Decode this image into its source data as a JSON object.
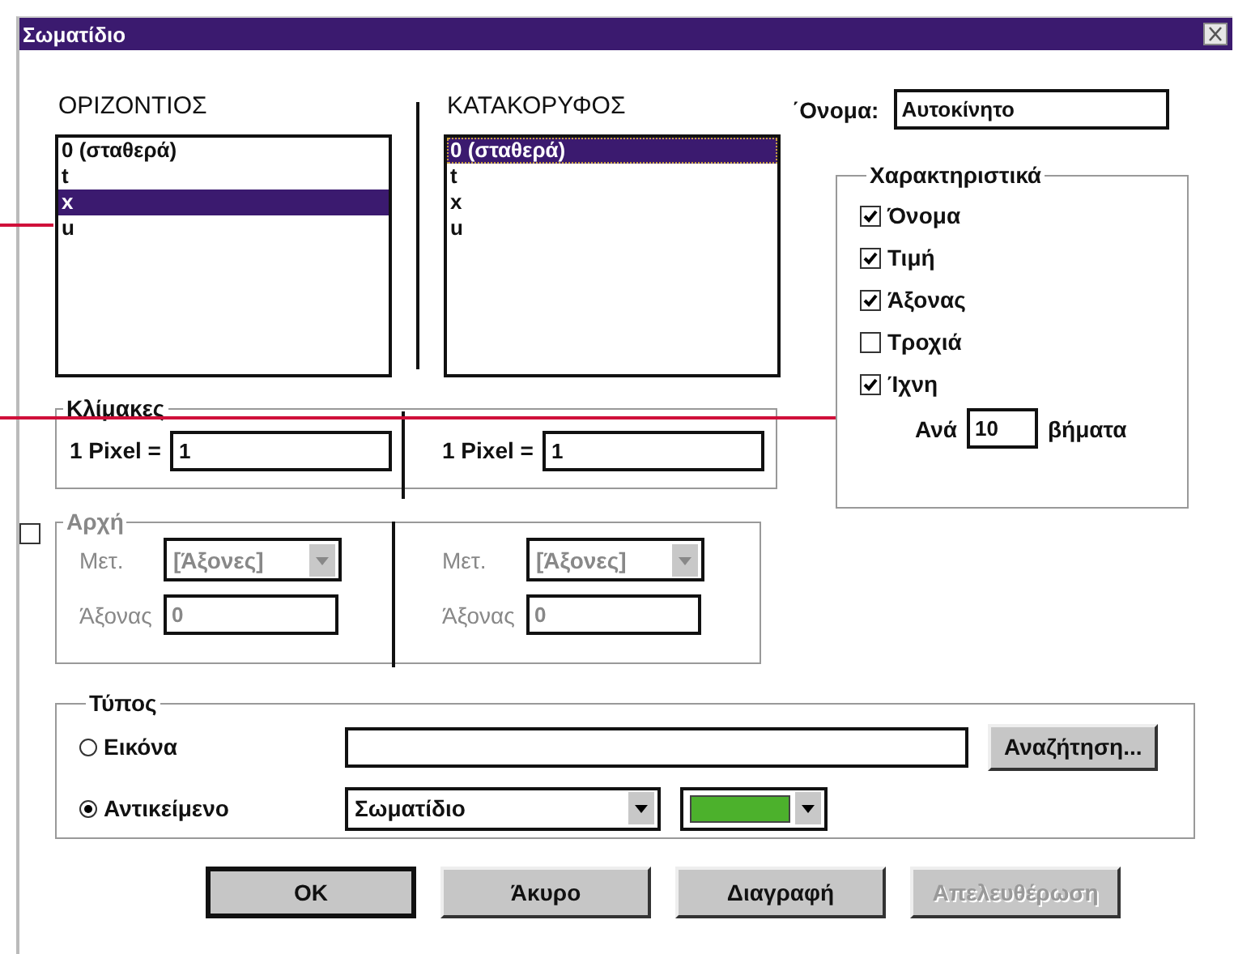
{
  "window": {
    "title": "Σωματίδιο"
  },
  "horizontal": {
    "heading": "ΟΡΙΖΟΝΤΙΟΣ",
    "items": [
      {
        "label": "0 (σταθερά)",
        "selected": false
      },
      {
        "label": "t",
        "selected": false
      },
      {
        "label": "x",
        "selected": true
      },
      {
        "label": "u",
        "selected": false
      }
    ]
  },
  "vertical": {
    "heading": "ΚΑΤΑΚΟΡΥΦΟΣ",
    "items": [
      {
        "label": "0 (σταθερά)",
        "selected": true
      },
      {
        "label": "t",
        "selected": false
      },
      {
        "label": "x",
        "selected": false
      },
      {
        "label": "u",
        "selected": false
      }
    ]
  },
  "name": {
    "label": "΄Ονομα:",
    "value": "Αυτοκίνητο"
  },
  "features": {
    "title": "Χαρακτηριστικά",
    "items": [
      {
        "label": "Όνομα",
        "checked": true
      },
      {
        "label": "Τιμή",
        "checked": true
      },
      {
        "label": "Άξονας",
        "checked": true
      },
      {
        "label": "Τροχιά",
        "checked": false
      },
      {
        "label": "Ίχνη",
        "checked": true
      }
    ],
    "step": {
      "prefix": "Ανά",
      "value": "10",
      "suffix": "βήματα"
    }
  },
  "scales": {
    "title": "Κλίμακες",
    "columns": [
      {
        "label": "1 Pixel =",
        "value": "1"
      },
      {
        "label": "1 Pixel =",
        "value": "1"
      }
    ]
  },
  "origin": {
    "title": "Αρχή",
    "checked": false,
    "disabled": true,
    "columns": [
      {
        "unit_label": "Μετ.",
        "unit_value": "[Άξονες]",
        "axis_label": "Άξονας",
        "axis_value": "0"
      },
      {
        "unit_label": "Μετ.",
        "unit_value": "[Άξονες]",
        "axis_label": "Άξονας",
        "axis_value": "0"
      }
    ]
  },
  "type": {
    "title": "Τύπος",
    "options": [
      {
        "kind": "file",
        "label": "Εικόνα",
        "selected": false,
        "button": "Αναζήτηση..."
      },
      {
        "kind": "object",
        "label": "Αντικείμενο",
        "selected": true,
        "value": "Σωματίδιο",
        "color": "#4cb12c"
      }
    ]
  },
  "buttons": [
    {
      "label": "OK",
      "default": true,
      "disabled": false
    },
    {
      "label": "Άκυρο",
      "default": false,
      "disabled": false
    },
    {
      "label": "Διαγραφή",
      "default": false,
      "disabled": false
    },
    {
      "label": "Απελευθέρωση",
      "default": false,
      "disabled": true
    }
  ]
}
